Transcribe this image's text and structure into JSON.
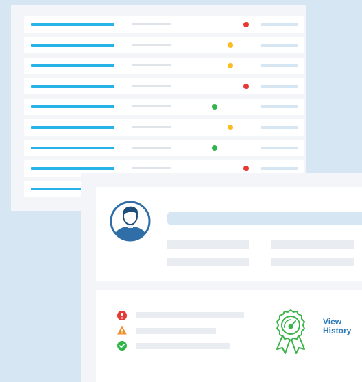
{
  "rows": [
    {
      "status": "red",
      "dot_color": "#e53935"
    },
    {
      "status": "yellow",
      "dot_color": "#fbbd23"
    },
    {
      "status": "yellow",
      "dot_color": "#fbbd23"
    },
    {
      "status": "red",
      "dot_color": "#e53935"
    },
    {
      "status": "green",
      "dot_color": "#2fb54a"
    },
    {
      "status": "yellow",
      "dot_color": "#fbbd23"
    },
    {
      "status": "green",
      "dot_color": "#2fb54a"
    },
    {
      "status": "red",
      "dot_color": "#e53935"
    },
    {
      "status": "none"
    }
  ],
  "profile": {
    "avatar_icon": "user-avatar-icon"
  },
  "status_items": [
    {
      "icon": "error-icon",
      "color": "#e53935"
    },
    {
      "icon": "warning-icon",
      "color": "#f08a24"
    },
    {
      "icon": "check-icon",
      "color": "#2fb54a"
    }
  ],
  "history": {
    "icon": "award-ribbon-icon",
    "line1": "View",
    "line2": "History"
  },
  "colors": {
    "background": "#d7e6f3",
    "accent_blue": "#27b2e8",
    "link_blue": "#2a7ab8",
    "avatar_blue": "#2f6ea6",
    "award_green": "#3bb44a"
  }
}
